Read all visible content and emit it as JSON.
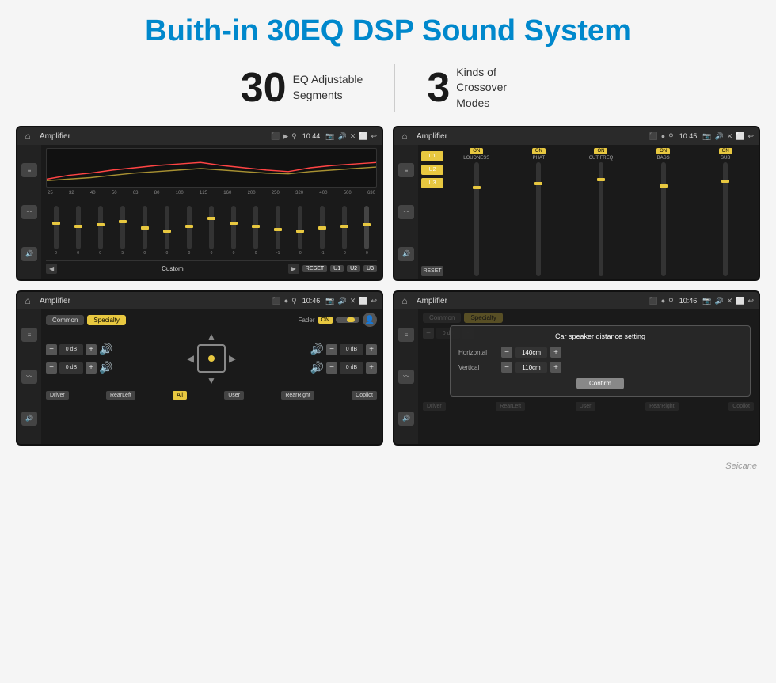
{
  "header": {
    "title": "Buith-in 30EQ DSP Sound System"
  },
  "stats": [
    {
      "number": "30",
      "label": "EQ Adjustable\nSegments"
    },
    {
      "number": "3",
      "label": "Kinds of\nCrossover Modes"
    }
  ],
  "screens": [
    {
      "id": "screen1",
      "title": "Amplifier",
      "time": "10:44",
      "type": "eq",
      "freqs": [
        "25",
        "32",
        "40",
        "50",
        "63",
        "80",
        "100",
        "125",
        "160",
        "200",
        "250",
        "320",
        "400",
        "500",
        "630"
      ],
      "sliderPositions": [
        45,
        50,
        55,
        48,
        42,
        38,
        45,
        60,
        55,
        50,
        45,
        42,
        48,
        50,
        55
      ],
      "sliderValues": [
        "0",
        "0",
        "0",
        "5",
        "0",
        "0",
        "0",
        "0",
        "0",
        "0",
        "-1",
        "0",
        "-1"
      ],
      "controls": [
        "◀",
        "Custom",
        "▶",
        "RESET",
        "U1",
        "U2",
        "U3"
      ]
    },
    {
      "id": "screen2",
      "title": "Amplifier",
      "time": "10:45",
      "type": "crossover",
      "presets": [
        "U1",
        "U2",
        "U3"
      ],
      "bands": [
        {
          "name": "LOUDNESS",
          "on": true
        },
        {
          "name": "PHAT",
          "on": true
        },
        {
          "name": "CUT FREQ",
          "on": true
        },
        {
          "name": "BASS",
          "on": true
        },
        {
          "name": "SUB",
          "on": true
        }
      ]
    },
    {
      "id": "screen3",
      "title": "Amplifier",
      "time": "10:46",
      "type": "fader",
      "tabs": [
        "Common",
        "Specialty"
      ],
      "activeTab": "Specialty",
      "faderLabel": "Fader",
      "faderOn": "ON",
      "controls": [
        {
          "db": "0 dB"
        },
        {
          "db": "0 dB"
        },
        {
          "db": "0 dB"
        },
        {
          "db": "0 dB"
        }
      ],
      "bottomButtons": [
        "Driver",
        "RearLeft",
        "All",
        "User",
        "RearRight",
        "Copilot"
      ]
    },
    {
      "id": "screen4",
      "title": "Amplifier",
      "time": "10:46",
      "type": "distance",
      "tabs": [
        "Common",
        "Specialty"
      ],
      "activeTab": "Specialty",
      "dialog": {
        "title": "Car speaker distance setting",
        "horizontal_label": "Horizontal",
        "horizontal_value": "140cm",
        "vertical_label": "Vertical",
        "vertical_value": "110cm",
        "confirm_btn": "Confirm"
      },
      "bottomButtons": [
        "Driver",
        "RearLeft",
        "User",
        "RearRight",
        "Copilot"
      ]
    }
  ],
  "watermark": "Seicane",
  "icons": {
    "home": "⌂",
    "back": "↩",
    "location": "📍",
    "camera": "📷",
    "volume": "🔊",
    "close": "✕",
    "window": "⬜",
    "user": "👤",
    "arrow_up": "▲",
    "arrow_down": "▼",
    "arrow_left": "◀",
    "arrow_right": "▶",
    "minus": "−",
    "plus": "+"
  }
}
